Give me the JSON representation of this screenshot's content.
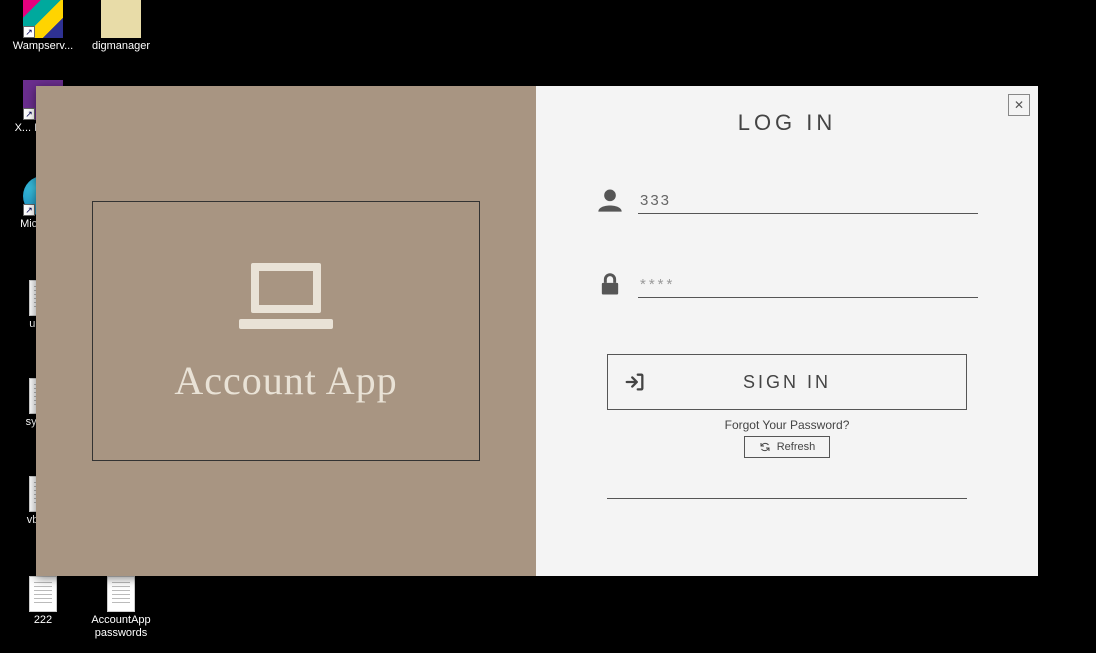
{
  "desktop": {
    "icons": [
      {
        "label": "Wampserv..."
      },
      {
        "label": "digmanager"
      },
      {
        "label": "X... Desig..."
      },
      {
        "label": "Mic... E..."
      },
      {
        "label": "upg..."
      },
      {
        "label": "syste..."
      },
      {
        "label": "vbite..."
      },
      {
        "label": "222"
      },
      {
        "label": "AccountApp passwords"
      }
    ]
  },
  "login": {
    "brand": "Account App",
    "title": "LOG IN",
    "username_value": "333",
    "password_placeholder": "****",
    "signin_label": "SIGN IN",
    "forgot_label": "Forgot Your Password?",
    "refresh_label": "Refresh",
    "close_glyph": "✕"
  }
}
